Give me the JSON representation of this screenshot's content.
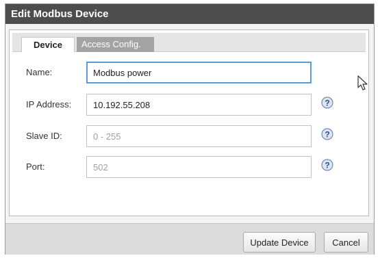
{
  "dialog": {
    "title": "Edit Modbus Device"
  },
  "tabs": [
    {
      "label": "Device",
      "active": true
    },
    {
      "label": "Access Config.",
      "active": false
    }
  ],
  "form": {
    "name": {
      "label": "Name:",
      "value": "Modbus power",
      "placeholder": ""
    },
    "ip_address": {
      "label": "IP Address:",
      "value": "10.192.55.208",
      "placeholder": ""
    },
    "slave_id": {
      "label": "Slave ID:",
      "value": "",
      "placeholder": "0 - 255"
    },
    "port": {
      "label": "Port:",
      "value": "",
      "placeholder": "502"
    }
  },
  "help_icon": "question-help-icon",
  "buttons": {
    "update": "Update Device",
    "cancel": "Cancel"
  },
  "colors": {
    "titlebar": "#4d4d4d",
    "active_tab": "#ffffff",
    "inactive_tab": "#a3a3a3",
    "focus_border": "#5b9bd6",
    "help_icon": "#3f5f96"
  }
}
